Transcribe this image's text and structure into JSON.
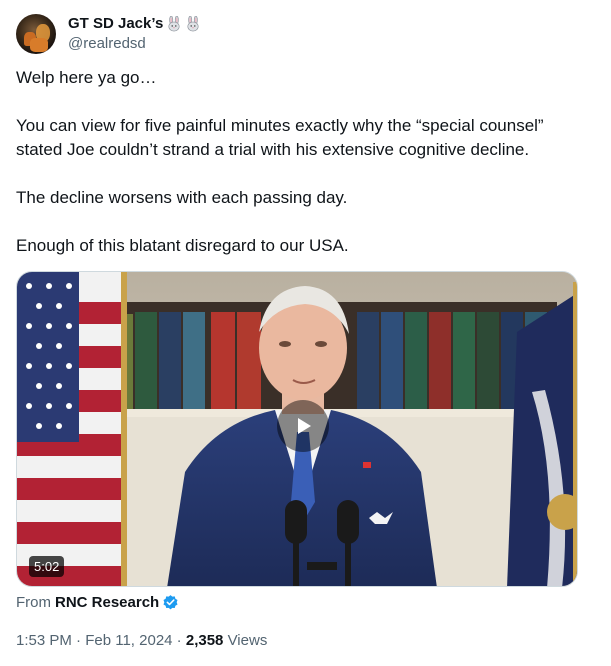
{
  "author": {
    "display_name": "GT SD Jack’s",
    "handle": "@realredsd",
    "avatar_icon": "profile-avatar",
    "name_emoji": [
      "rabbit-icon",
      "rabbit-icon"
    ]
  },
  "tweet": {
    "paragraphs": [
      "Welp here ya go…",
      "You can view for five painful minutes exactly why the “special counsel” stated Joe couldn’t strand a trial with his extensive cognitive decline.",
      "The decline worsens with each passing day.",
      "Enough of this blatant disregard to our USA."
    ]
  },
  "media": {
    "duration": "5:02",
    "play_icon": "play-icon"
  },
  "source": {
    "prefix": "From",
    "name": "RNC Research",
    "verified_color": "#1d9bf0"
  },
  "meta": {
    "time": "1:53 PM",
    "separator": " · ",
    "date": "Feb 11, 2024",
    "views_count": "2,358",
    "views_label": " Views"
  }
}
